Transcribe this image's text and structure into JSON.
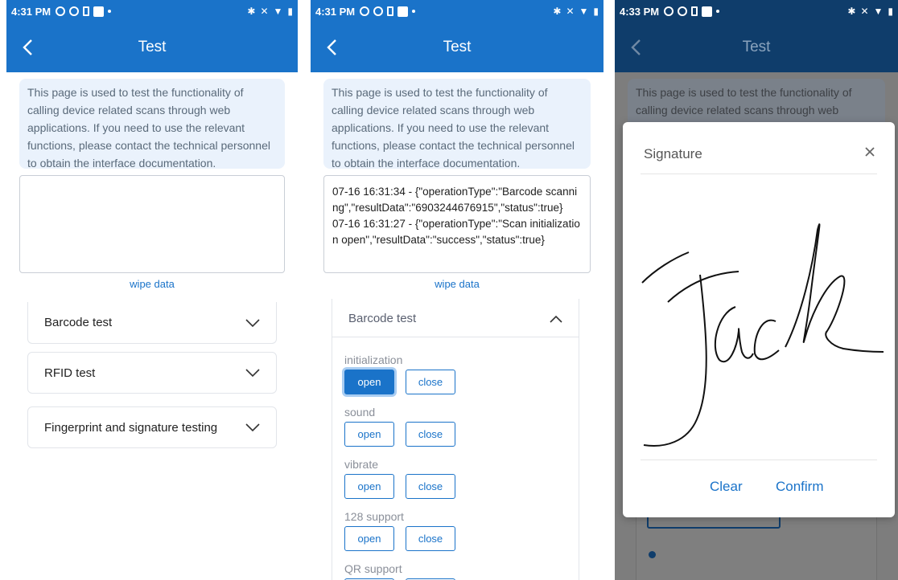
{
  "status_left": {
    "time": "4:31 PM"
  },
  "status_right": {
    "time": "4:33 PM"
  },
  "app": {
    "title": "Test"
  },
  "info_text": "This page is used to test the functionality of calling device related scans through web applications. If you need to use the relevant functions, please contact the technical personnel to obtain the interface documentation.",
  "wipe_label": "wipe data",
  "log_text": "07-16 16:31:34 - {\"operationType\":\"Barcode scanning\",\"resultData\":\"6903244676915\",\"status\":true}\n07-16 16:31:27 - {\"operationType\":\"Scan initialization open\",\"resultData\":\"success\",\"status\":true}",
  "sections": [
    "Barcode test",
    "RFID test",
    "Fingerprint and signature testing"
  ],
  "barcode_groups": [
    "initialization",
    "sound",
    "vibrate",
    "128 support",
    "QR support"
  ],
  "btn_open": "open",
  "btn_close": "close",
  "signature": {
    "title": "Signature",
    "clear": "Clear",
    "confirm": "Confirm"
  },
  "colors": {
    "primary": "#1a73c9",
    "info_bg": "#eaf2fc",
    "overlay_bar": "#0f3d6b"
  }
}
